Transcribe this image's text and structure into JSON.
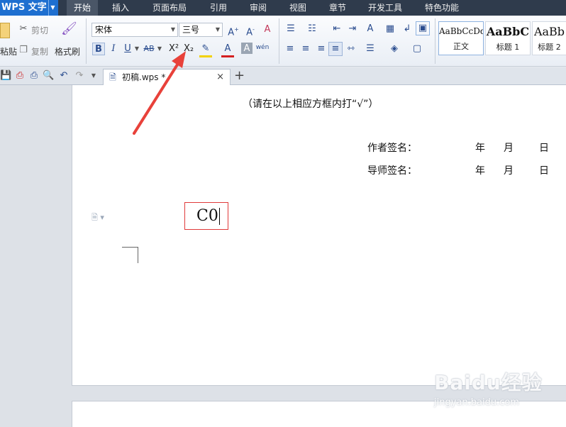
{
  "app": {
    "title": "WPS 文字",
    "dropdown_glyph": "▼"
  },
  "menu_tabs": [
    "开始",
    "插入",
    "页面布局",
    "引用",
    "审阅",
    "视图",
    "章节",
    "开发工具",
    "特色功能"
  ],
  "ribbon": {
    "paste_label": "粘贴",
    "cut_label": "剪切",
    "copy_label": "复制",
    "format_painter_label": "格式刷",
    "font_name": "宋体",
    "font_size": "三号",
    "bold": "B",
    "italic": "I",
    "underline": "U",
    "strikethrough": "AB",
    "superscript": "X²",
    "subscript": "X₂",
    "styles": [
      {
        "sample": "AaBbCcDd",
        "name": "正文"
      },
      {
        "sample": "AaBbC",
        "name": "标题 1"
      },
      {
        "sample": "AaBb",
        "name": "标题 2"
      }
    ]
  },
  "quick_access_icons": [
    "save-icon",
    "pdf-icon",
    "print-icon",
    "print-preview-icon",
    "undo-icon",
    "redo-icon"
  ],
  "doc_tab": {
    "name": "初稿.wps *",
    "close_glyph": "×",
    "new_glyph": "+"
  },
  "document": {
    "instruction": "（请在以上相应方框内打“√”）",
    "author_sig": "作者签名：",
    "advisor_sig": "导师签名：",
    "date_year": "年",
    "date_month": "月",
    "date_day": "日",
    "textbox_value": "C0"
  },
  "watermark": {
    "logo": "Baidu经验",
    "sub": "jingyan.baidu.com"
  },
  "colors": {
    "menubar": "#2f3b4c",
    "app_button": "#1e6fd0",
    "textbox_border": "#e03a3a",
    "arrow": "#e8413a"
  }
}
